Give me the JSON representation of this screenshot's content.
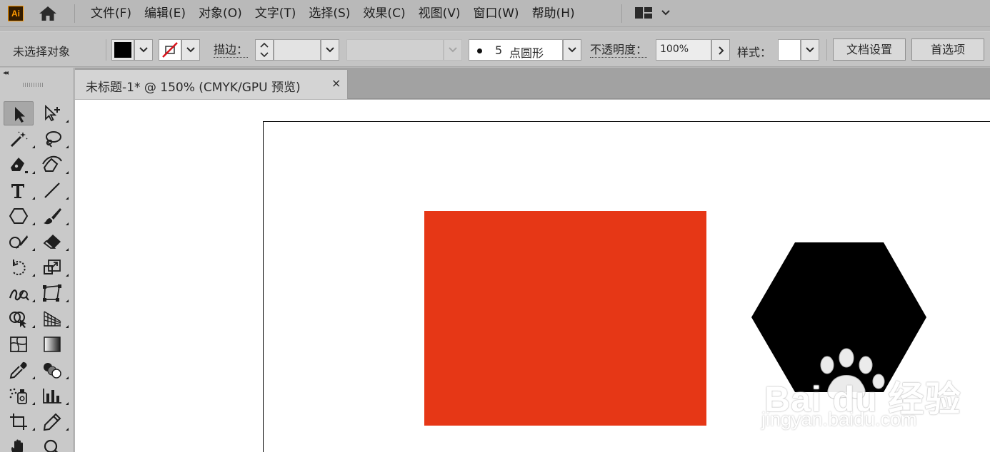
{
  "app": {
    "logo_text": "Ai"
  },
  "menu": {
    "items": [
      "文件(F)",
      "编辑(E)",
      "对象(O)",
      "文字(T)",
      "选择(S)",
      "效果(C)",
      "视图(V)",
      "窗口(W)",
      "帮助(H)"
    ]
  },
  "controlbar": {
    "selection_status": "未选择对象",
    "stroke_label": "描边：",
    "brush_size": "5",
    "brush_name": "点圆形",
    "opacity_label": "不透明度：",
    "opacity_value": "100%",
    "style_label": "样式：",
    "doc_setup_button": "文档设置",
    "preferences_button": "首选项"
  },
  "document": {
    "tab_title": "未标题-1* @ 150% (CMYK/GPU 预览)",
    "close_glyph": "×"
  },
  "colors": {
    "fill": "#000000",
    "rectangle": "#e63716",
    "hexagon": "#000000",
    "no_stroke_slash": "#d9121a"
  },
  "watermark": {
    "brand": "Bai  du 经验",
    "url": "jingyan.baidu.com"
  }
}
